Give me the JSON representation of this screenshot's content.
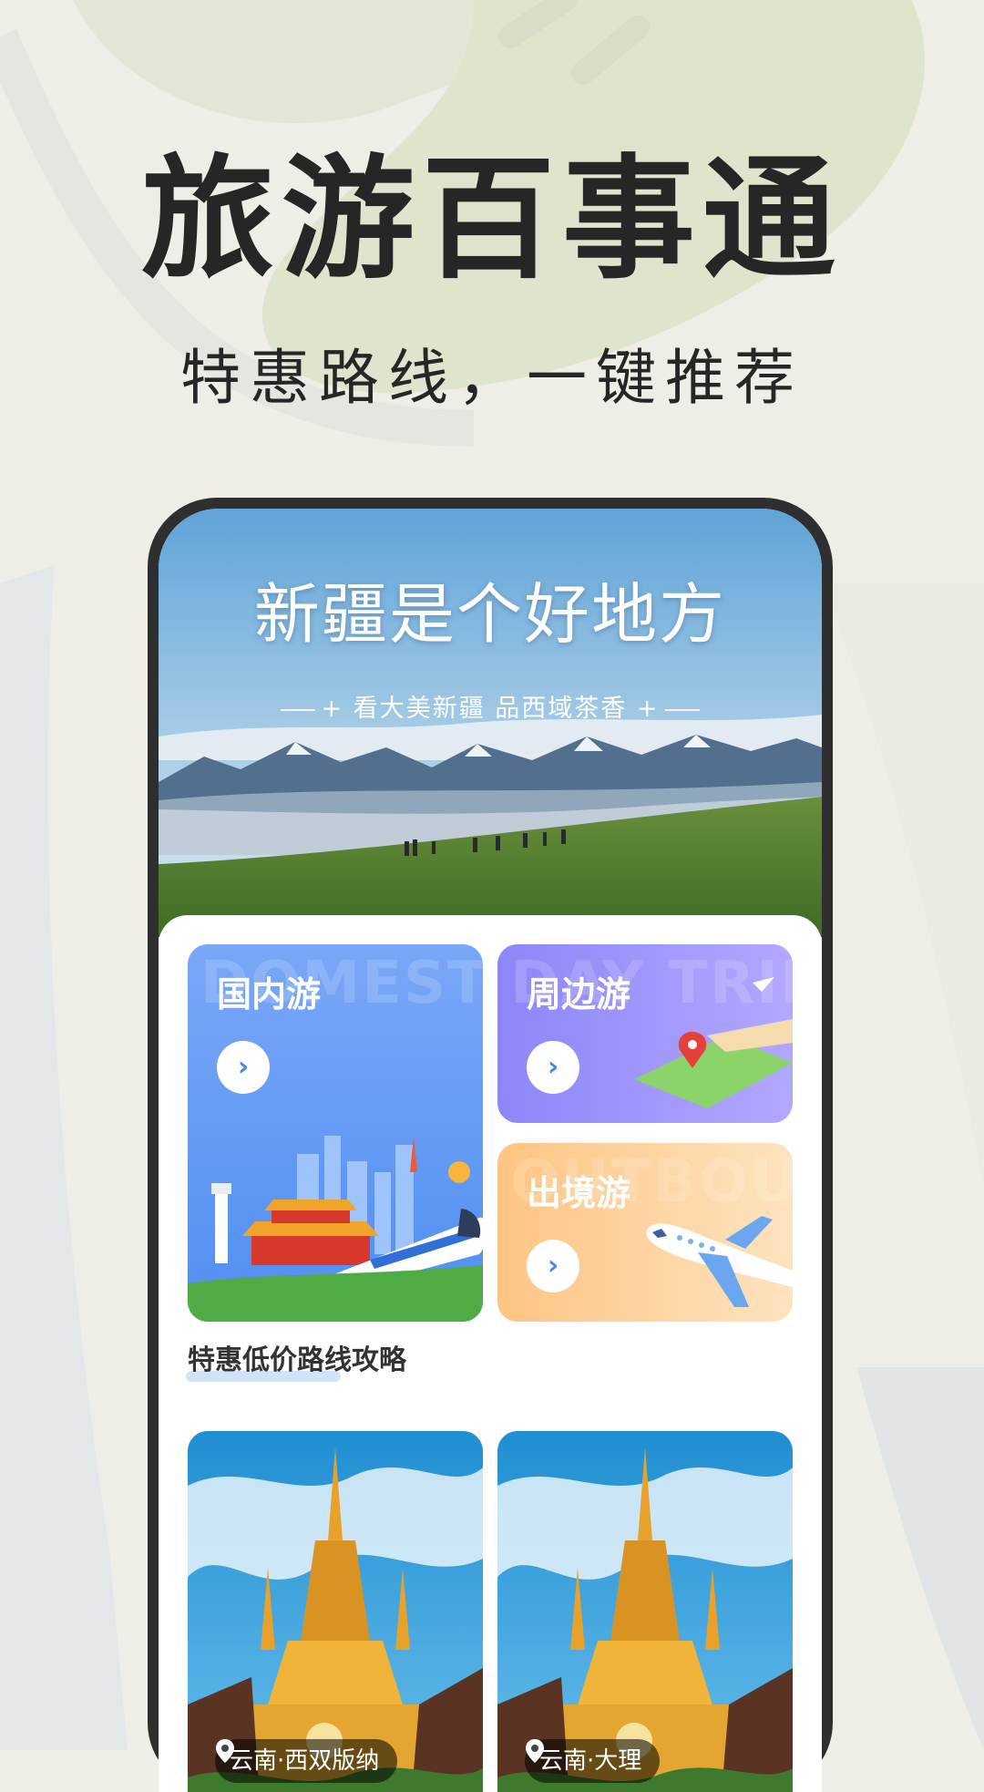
{
  "hero": {
    "title": "旅游百事通",
    "subtitle": "特惠路线，一键推荐"
  },
  "banner": {
    "title": "新疆是个好地方",
    "subtitle": "看大美新疆 品西域茶香"
  },
  "categories": [
    {
      "label": "国内游",
      "watermark": "DOMESTIC",
      "icon": "chevron-right-icon",
      "color": "#6f9ff6"
    },
    {
      "label": "周边游",
      "watermark": "DAY TRIP",
      "icon": "chevron-right-icon",
      "color": "#9e93fb"
    },
    {
      "label": "出境游",
      "watermark": "OUTBOUND",
      "icon": "chevron-right-icon",
      "color": "#fcc98a"
    }
  ],
  "section": {
    "title": "特惠低价路线攻略"
  },
  "routes": [
    {
      "location": "云南·西双版纳",
      "icon": "location-pin-icon"
    },
    {
      "location": "云南·大理",
      "icon": "location-pin-icon"
    }
  ],
  "colors": {
    "background": "#eeede6",
    "phone_frame": "#2f2f2f",
    "accent_blue": "#4a86ef",
    "text_dark": "#262626"
  }
}
